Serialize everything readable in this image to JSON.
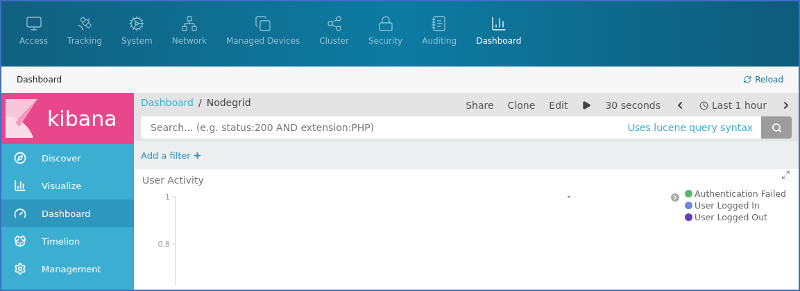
{
  "top_nav": [
    {
      "label": "Access",
      "selected": false
    },
    {
      "label": "Tracking",
      "selected": false
    },
    {
      "label": "System",
      "selected": false
    },
    {
      "label": "Network",
      "selected": false
    },
    {
      "label": "Managed Devices",
      "selected": false
    },
    {
      "label": "Cluster",
      "selected": false
    },
    {
      "label": "Security",
      "selected": false
    },
    {
      "label": "Auditing",
      "selected": false
    },
    {
      "label": "Dashboard",
      "selected": true
    }
  ],
  "subbar": {
    "title": "Dashboard",
    "reload": "Reload"
  },
  "kibana": {
    "logo_text": "kibana",
    "nav": [
      {
        "label": "Discover",
        "selected": false
      },
      {
        "label": "Visualize",
        "selected": false
      },
      {
        "label": "Dashboard",
        "selected": true
      },
      {
        "label": "Timelion",
        "selected": false
      },
      {
        "label": "Management",
        "selected": false
      }
    ]
  },
  "breadcrumb": {
    "items": [
      "Dashboard",
      "Nodegrid"
    ],
    "separator": "/"
  },
  "toolbar": {
    "share": "Share",
    "clone": "Clone",
    "edit": "Edit",
    "interval": "30 seconds",
    "time_range": "Last 1 hour"
  },
  "search": {
    "placeholder": "Search... (e.g. status:200 AND extension:PHP)",
    "syntax_link": "Uses lucene query syntax"
  },
  "filter": {
    "add": "Add a filter"
  },
  "panel": {
    "title": "User Activity",
    "y_axis_labels": [
      "1",
      "0.8"
    ],
    "legend": [
      {
        "name": "Authentication Failed",
        "color": "#54b86f"
      },
      {
        "name": "User Logged In",
        "color": "#6f87d8"
      },
      {
        "name": "User Logged Out",
        "color": "#663db8"
      }
    ]
  }
}
